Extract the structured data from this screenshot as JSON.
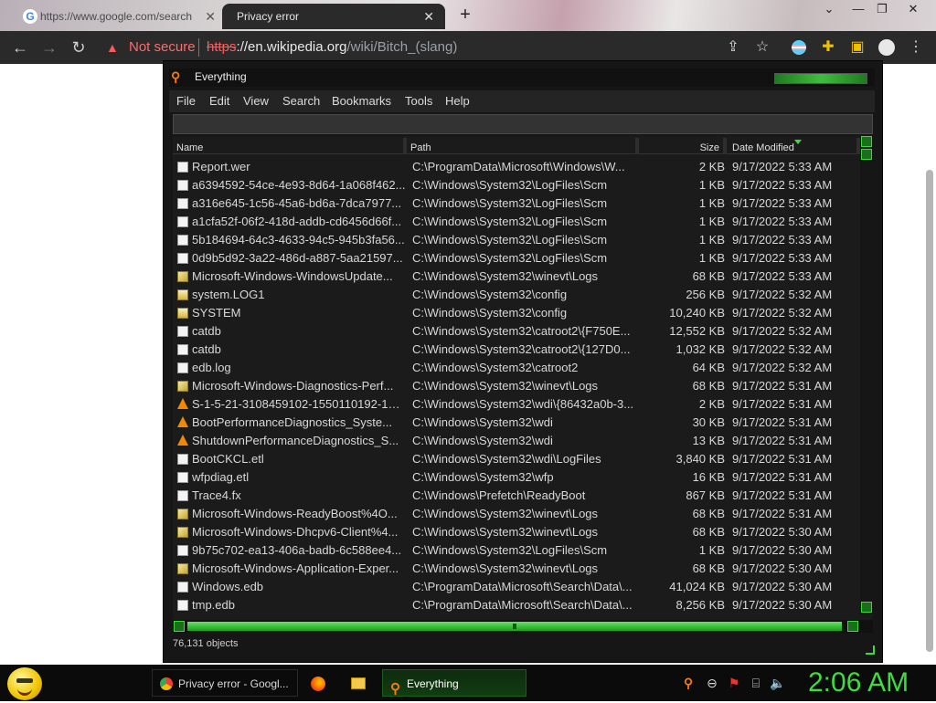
{
  "browser": {
    "tabs": [
      {
        "title": "https://www.google.com/search",
        "icon": "google-icon"
      },
      {
        "title": "Privacy error",
        "icon": "none"
      }
    ],
    "new_tab": "+",
    "close_glyph": "✕",
    "not_secure": "Not secure",
    "url_scheme": "https",
    "url_host": "://en.wikipedia.org",
    "url_path": "/wiki/Bitch_(slang)"
  },
  "everything": {
    "title": "Everything",
    "menu": [
      "File",
      "Edit",
      "View",
      "Search",
      "Bookmarks",
      "Tools",
      "Help"
    ],
    "search_value": "",
    "columns": {
      "name": "Name",
      "path": "Path",
      "size": "Size",
      "date": "Date Modified"
    },
    "rows": [
      {
        "icon": "doc",
        "name": "Report.wer",
        "path": "C:\\ProgramData\\Microsoft\\Windows\\W...",
        "size": "2 KB",
        "date": "9/17/2022 5:33 AM"
      },
      {
        "icon": "doc",
        "name": "a6394592-54ce-4e93-8d64-1a068f462...",
        "path": "C:\\Windows\\System32\\LogFiles\\Scm",
        "size": "1 KB",
        "date": "9/17/2022 5:33 AM"
      },
      {
        "icon": "doc",
        "name": "a316e645-1c56-45a6-bd6a-7dca7977...",
        "path": "C:\\Windows\\System32\\LogFiles\\Scm",
        "size": "1 KB",
        "date": "9/17/2022 5:33 AM"
      },
      {
        "icon": "doc",
        "name": "a1cfa52f-06f2-418d-addb-cd6456d66f...",
        "path": "C:\\Windows\\System32\\LogFiles\\Scm",
        "size": "1 KB",
        "date": "9/17/2022 5:33 AM"
      },
      {
        "icon": "doc",
        "name": "5b184694-64c3-4633-94c5-945b3fa56...",
        "path": "C:\\Windows\\System32\\LogFiles\\Scm",
        "size": "1 KB",
        "date": "9/17/2022 5:33 AM"
      },
      {
        "icon": "doc",
        "name": "0d9b5d92-3a22-486d-a887-5aa21597...",
        "path": "C:\\Windows\\System32\\LogFiles\\Scm",
        "size": "1 KB",
        "date": "9/17/2022 5:33 AM"
      },
      {
        "icon": "evt",
        "name": "Microsoft-Windows-WindowsUpdate...",
        "path": "C:\\Windows\\System32\\winevt\\Logs",
        "size": "68 KB",
        "date": "9/17/2022 5:33 AM"
      },
      {
        "icon": "lock",
        "name": "system.LOG1",
        "path": "C:\\Windows\\System32\\config",
        "size": "256 KB",
        "date": "9/17/2022 5:32 AM"
      },
      {
        "icon": "lock",
        "name": "SYSTEM",
        "path": "C:\\Windows\\System32\\config",
        "size": "10,240 KB",
        "date": "9/17/2022 5:32 AM"
      },
      {
        "icon": "doc",
        "name": "catdb",
        "path": "C:\\Windows\\System32\\catroot2\\{F750E...",
        "size": "12,552 KB",
        "date": "9/17/2022 5:32 AM"
      },
      {
        "icon": "doc",
        "name": "catdb",
        "path": "C:\\Windows\\System32\\catroot2\\{127D0...",
        "size": "1,032 KB",
        "date": "9/17/2022 5:32 AM"
      },
      {
        "icon": "doc",
        "name": "edb.log",
        "path": "C:\\Windows\\System32\\catroot2",
        "size": "64 KB",
        "date": "9/17/2022 5:32 AM"
      },
      {
        "icon": "evt",
        "name": "Microsoft-Windows-Diagnostics-Perf...",
        "path": "C:\\Windows\\System32\\winevt\\Logs",
        "size": "68 KB",
        "date": "9/17/2022 5:31 AM"
      },
      {
        "icon": "cone",
        "name": "S-1-5-21-3108459102-1550110192-190...",
        "path": "C:\\Windows\\System32\\wdi\\{86432a0b-3...",
        "size": "2 KB",
        "date": "9/17/2022 5:31 AM"
      },
      {
        "icon": "cone",
        "name": "BootPerformanceDiagnostics_Syste...",
        "path": "C:\\Windows\\System32\\wdi",
        "size": "30 KB",
        "date": "9/17/2022 5:31 AM"
      },
      {
        "icon": "cone",
        "name": "ShutdownPerformanceDiagnostics_S...",
        "path": "C:\\Windows\\System32\\wdi",
        "size": "13 KB",
        "date": "9/17/2022 5:31 AM"
      },
      {
        "icon": "doc",
        "name": "BootCKCL.etl",
        "path": "C:\\Windows\\System32\\wdi\\LogFiles",
        "size": "3,840 KB",
        "date": "9/17/2022 5:31 AM"
      },
      {
        "icon": "doc",
        "name": "wfpdiag.etl",
        "path": "C:\\Windows\\System32\\wfp",
        "size": "16 KB",
        "date": "9/17/2022 5:31 AM"
      },
      {
        "icon": "doc",
        "name": "Trace4.fx",
        "path": "C:\\Windows\\Prefetch\\ReadyBoot",
        "size": "867 KB",
        "date": "9/17/2022 5:31 AM"
      },
      {
        "icon": "evt",
        "name": "Microsoft-Windows-ReadyBoost%4O...",
        "path": "C:\\Windows\\System32\\winevt\\Logs",
        "size": "68 KB",
        "date": "9/17/2022 5:31 AM"
      },
      {
        "icon": "evt",
        "name": "Microsoft-Windows-Dhcpv6-Client%4...",
        "path": "C:\\Windows\\System32\\winevt\\Logs",
        "size": "68 KB",
        "date": "9/17/2022 5:30 AM"
      },
      {
        "icon": "doc",
        "name": "9b75c702-ea13-406a-badb-6c588ee4...",
        "path": "C:\\Windows\\System32\\LogFiles\\Scm",
        "size": "1 KB",
        "date": "9/17/2022 5:30 AM"
      },
      {
        "icon": "evt",
        "name": "Microsoft-Windows-Application-Exper...",
        "path": "C:\\Windows\\System32\\winevt\\Logs",
        "size": "68 KB",
        "date": "9/17/2022 5:30 AM"
      },
      {
        "icon": "doc",
        "name": "Windows.edb",
        "path": "C:\\ProgramData\\Microsoft\\Search\\Data\\...",
        "size": "41,024 KB",
        "date": "9/17/2022 5:30 AM"
      },
      {
        "icon": "doc",
        "name": "tmp.edb",
        "path": "C:\\ProgramData\\Microsoft\\Search\\Data\\...",
        "size": "8,256 KB",
        "date": "9/17/2022 5:30 AM"
      }
    ],
    "status": "76,131 objects"
  },
  "taskbar": {
    "tasks": [
      {
        "label": "Privacy error - Googl...",
        "icon": "chrome-icon"
      },
      {
        "label": "",
        "icon": "firefox-icon"
      },
      {
        "label": "",
        "icon": "folder-icon"
      },
      {
        "label": "Everything",
        "icon": "everything-icon"
      }
    ],
    "clock": "2:06 AM"
  },
  "colors": {
    "accent": "#3fdc3f",
    "warning": "#ff5a5a",
    "everything_orange": "#ff7a00"
  }
}
